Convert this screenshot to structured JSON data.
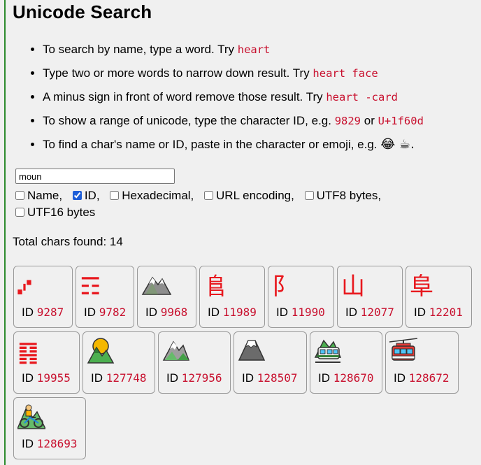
{
  "title": "Unicode Search",
  "tips": [
    {
      "text": "To search by name, type a word. Try ",
      "code1": "heart",
      "mid": "",
      "code2": "",
      "tail": ""
    },
    {
      "text": "Type two or more words to narrow down result. Try ",
      "code1": "heart face",
      "mid": "",
      "code2": "",
      "tail": ""
    },
    {
      "text": "A minus sign in front of word remove those result. Try ",
      "code1": "heart -card",
      "mid": "",
      "code2": "",
      "tail": ""
    },
    {
      "text": "To show a range of unicode, type the character ID, e.g. ",
      "code1": "9829",
      "mid": " or ",
      "code2": "U+1f60d",
      "tail": ""
    },
    {
      "text": "To find a char's name or ID, paste in the character or emoji, e.g. ",
      "code1": "",
      "mid": "",
      "code2": "",
      "tail": "😂 ☕."
    }
  ],
  "search": {
    "value": "moun"
  },
  "options": [
    {
      "label": "Name,",
      "checked": false
    },
    {
      "label": "ID,",
      "checked": true
    },
    {
      "label": "Hexadecimal,",
      "checked": false
    },
    {
      "label": "URL encoding,",
      "checked": false
    },
    {
      "label": "UTF8 bytes,",
      "checked": false
    },
    {
      "label": "UTF16 bytes",
      "checked": false
    }
  ],
  "total_text": "Total chars found: 14",
  "id_prefix": "ID",
  "results": [
    {
      "id": "9287",
      "glyph": "⑇",
      "icon": "rain-dots-icon"
    },
    {
      "id": "9782",
      "glyph": "☶",
      "icon": "trigram-mountain-icon"
    },
    {
      "id": "9968",
      "glyph": "⛰",
      "icon": "mountain-icon"
    },
    {
      "id": "11989",
      "glyph": "⻕",
      "icon": "radical-mound-icon"
    },
    {
      "id": "11990",
      "glyph": "⻖",
      "icon": "radical-mound-two-icon"
    },
    {
      "id": "12077",
      "glyph": "⼭",
      "icon": "kangxi-mountain-icon"
    },
    {
      "id": "12201",
      "glyph": "⾩",
      "icon": "kangxi-mound-icon"
    },
    {
      "id": "19955",
      "glyph": "䷳",
      "icon": "hexagram-mountain-icon"
    },
    {
      "id": "127748",
      "glyph": "🌄",
      "icon": "sunrise-over-mountains-icon"
    },
    {
      "id": "127956",
      "glyph": "🏔",
      "icon": "snow-capped-mountain-icon"
    },
    {
      "id": "128507",
      "glyph": "🗻",
      "icon": "mount-fuji-icon"
    },
    {
      "id": "128670",
      "glyph": "🚞",
      "icon": "mountain-railway-icon"
    },
    {
      "id": "128672",
      "glyph": "🚠",
      "icon": "mountain-cableway-icon"
    },
    {
      "id": "128693",
      "glyph": "🚵",
      "icon": "mountain-bicyclist-icon"
    }
  ]
}
